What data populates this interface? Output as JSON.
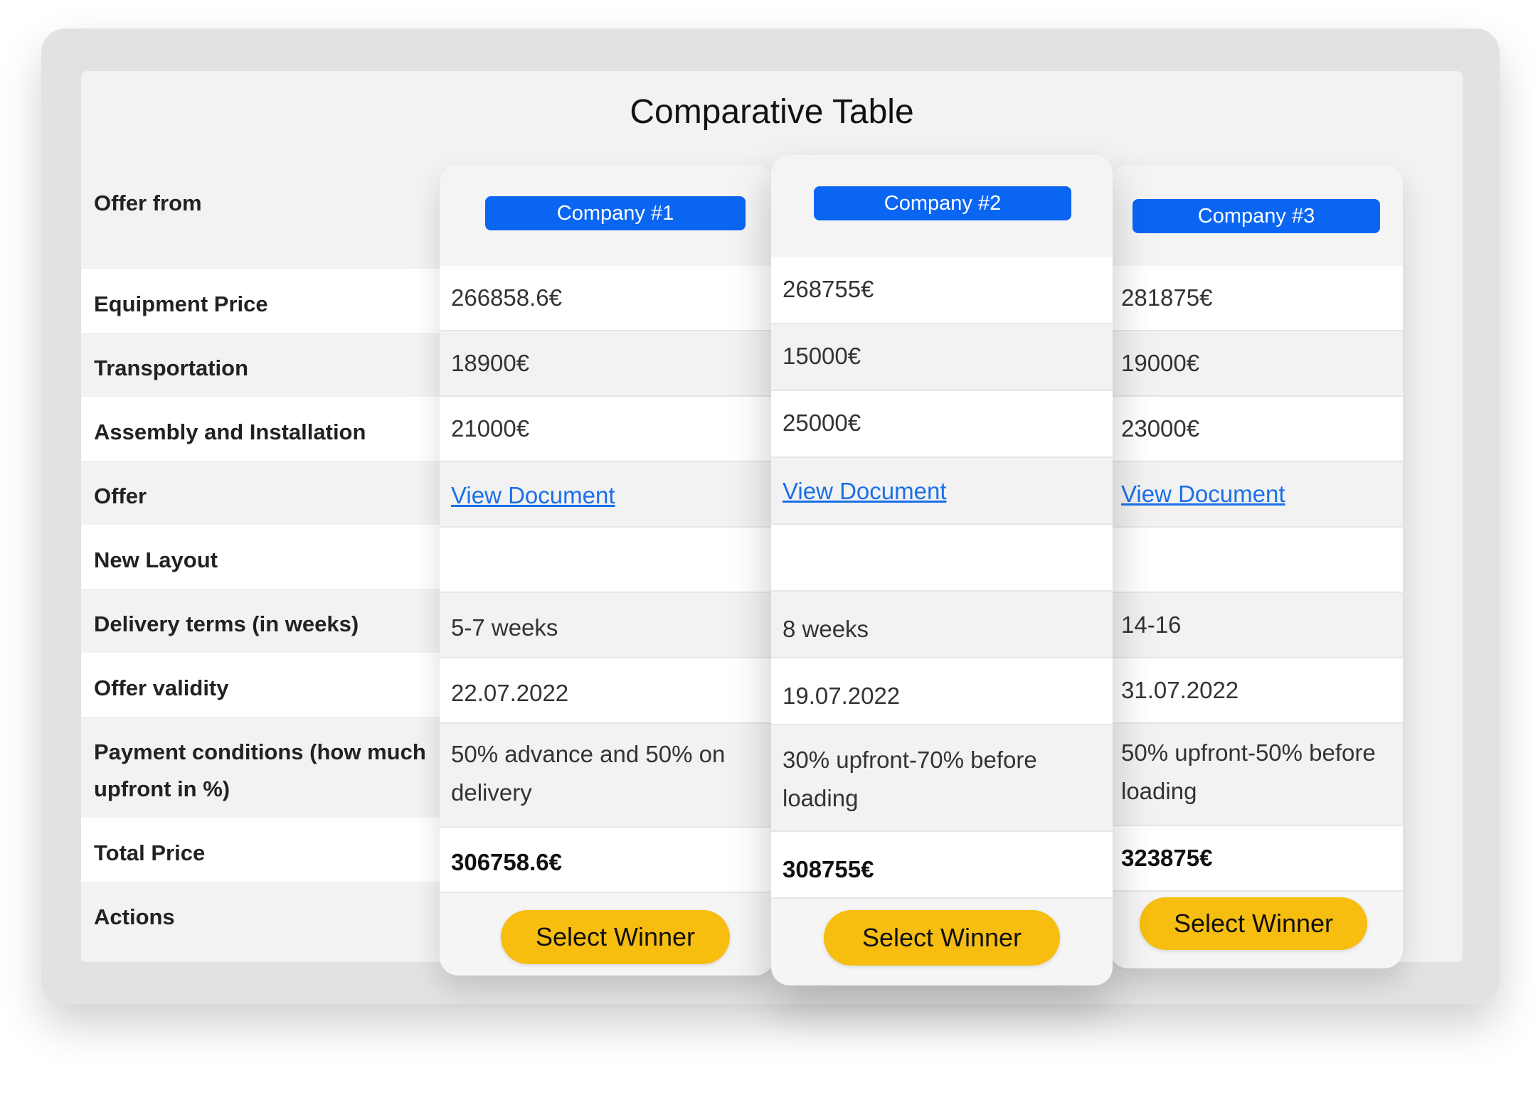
{
  "title": "Comparative Table",
  "row_labels": [
    "Offer from",
    "Equipment Price",
    "Transportation",
    "Assembly and Installation",
    "Offer",
    "New Layout",
    "Delivery terms (in weeks)",
    "Offer validity",
    "Payment conditions (how much upfront in %)",
    "Total Price",
    "Actions"
  ],
  "companies": [
    {
      "name": "Company #1",
      "equipment_price": "266858.6€",
      "transportation": "18900€",
      "assembly": "21000€",
      "offer_link": "View Document",
      "new_layout": "",
      "delivery": "5-7 weeks",
      "validity": "22.07.2022",
      "payment": "50% advance and 50% on delivery",
      "total": "306758.6€",
      "action": "Select Winner"
    },
    {
      "name": "Company #2",
      "equipment_price": "268755€",
      "transportation": "15000€",
      "assembly": "25000€",
      "offer_link": "View Document",
      "new_layout": "",
      "delivery": "8 weeks",
      "validity": "19.07.2022",
      "payment": "30% upfront-70% before loading",
      "total": "308755€",
      "action": "Select Winner"
    },
    {
      "name": "Company #3",
      "equipment_price": "281875€",
      "transportation": "19000€",
      "assembly": "23000€",
      "offer_link": "View Document",
      "new_layout": "",
      "delivery": "14-16",
      "validity": "31.07.2022",
      "payment": "50% upfront-50% before loading",
      "total": "323875€",
      "action": "Select Winner"
    }
  ],
  "colors": {
    "company_button": "#0a66f2",
    "select_button": "#f7bd0f",
    "link": "#1a6fe8"
  }
}
